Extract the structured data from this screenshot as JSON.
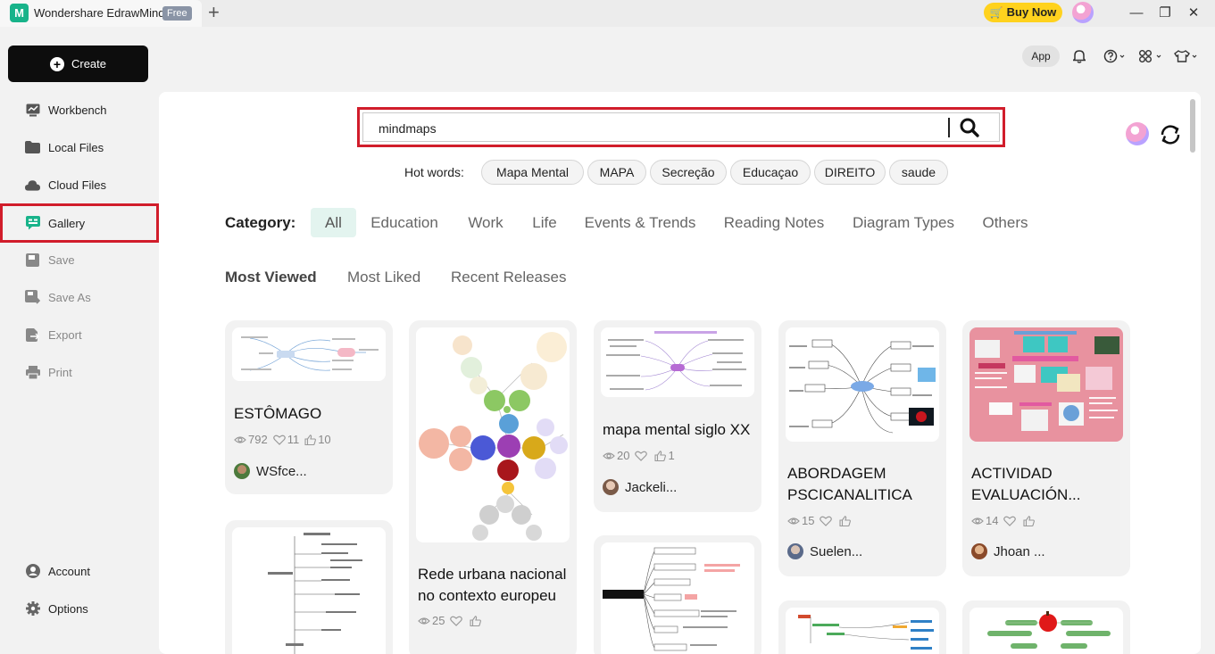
{
  "app": {
    "logo_glyph": "M",
    "name": "Wondershare EdrawMind",
    "badge": "Free",
    "new_tab_glyph": "+",
    "buy_now": "Buy Now",
    "window_controls": [
      "—",
      "❐",
      "✕"
    ]
  },
  "sidebar": {
    "create_label": "Create",
    "items": [
      {
        "label": "Workbench",
        "icon": "workbench-icon"
      },
      {
        "label": "Local Files",
        "icon": "folder-icon"
      },
      {
        "label": "Cloud Files",
        "icon": "cloud-icon"
      },
      {
        "label": "Gallery",
        "icon": "gallery-icon"
      },
      {
        "label": "Save",
        "icon": "save-icon"
      },
      {
        "label": "Save As",
        "icon": "save-as-icon"
      },
      {
        "label": "Export",
        "icon": "export-icon"
      },
      {
        "label": "Print",
        "icon": "print-icon"
      }
    ],
    "bottom": [
      {
        "label": "Account",
        "icon": "account-icon"
      },
      {
        "label": "Options",
        "icon": "options-gear-icon"
      }
    ]
  },
  "header": {
    "app_button": "App"
  },
  "search": {
    "value": "mindmaps"
  },
  "hot_words": {
    "label": "Hot words:",
    "chips": [
      "Mapa Mental",
      "MAPA",
      "Secreção",
      "Educaçao",
      "DIREITO",
      "saude"
    ]
  },
  "category": {
    "label": "Category:",
    "items": [
      "All",
      "Education",
      "Work",
      "Life",
      "Events & Trends",
      "Reading Notes",
      "Diagram Types",
      "Others"
    ],
    "selected": "All"
  },
  "sort": {
    "items": [
      "Most Viewed",
      "Most Liked",
      "Recent Releases"
    ],
    "selected": "Most Viewed"
  },
  "cards": [
    {
      "title": "ESTÔMAGO",
      "views": "792",
      "favorites": "11",
      "likes": "10",
      "author": "WSfce..."
    },
    {
      "title": "Rede urbana nacional no contexto europeu",
      "views": "25",
      "favorites": "",
      "likes": "",
      "author": ""
    },
    {
      "title": "mapa mental siglo XX",
      "views": "20",
      "favorites": "",
      "likes": "1",
      "author": "Jackeli..."
    },
    {
      "title": "ABORDAGEM PSCICANALITICA",
      "views": "15",
      "favorites": "",
      "likes": "",
      "author": "Suelen..."
    },
    {
      "title": "ACTIVIDAD EVALUACIÓN...",
      "views": "14",
      "favorites": "",
      "likes": "",
      "author": "Jhoan ..."
    }
  ],
  "colors": {
    "highlight_red": "#d11d2b",
    "buy_now_yellow": "#ffd21e",
    "category_active_bg": "#e3f4ef",
    "create_button": "#0d0d0d"
  }
}
